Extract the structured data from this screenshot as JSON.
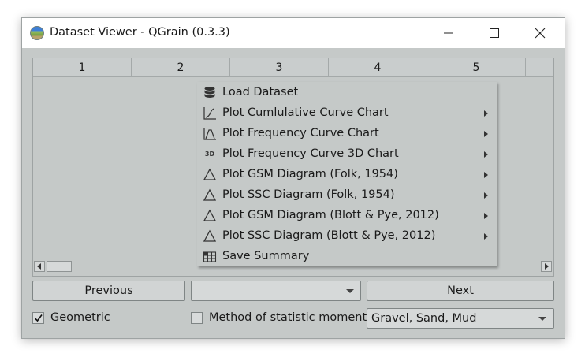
{
  "window": {
    "title": "Dataset Viewer - QGrain (0.3.3)"
  },
  "table": {
    "columns": [
      "1",
      "2",
      "3",
      "4",
      "5"
    ]
  },
  "context_menu": {
    "items": [
      {
        "label": "Load Dataset",
        "icon": "database-icon",
        "submenu": false
      },
      {
        "label": "Plot Cumlulative Curve Chart",
        "icon": "cumulative-chart-icon",
        "submenu": true
      },
      {
        "label": "Plot Frequency Curve Chart",
        "icon": "frequency-chart-icon",
        "submenu": true
      },
      {
        "label": "Plot Frequency Curve 3D Chart",
        "icon": "3d-chart-icon",
        "icon_text": "3D",
        "submenu": true
      },
      {
        "label": "Plot GSM Diagram (Folk, 1954)",
        "icon": "triangle-icon",
        "submenu": true
      },
      {
        "label": "Plot SSC Diagram (Folk, 1954)",
        "icon": "triangle-icon",
        "submenu": true
      },
      {
        "label": "Plot GSM Diagram (Blott & Pye, 2012)",
        "icon": "triangle-icon",
        "submenu": true
      },
      {
        "label": "Plot SSC Diagram (Blott & Pye, 2012)",
        "icon": "triangle-icon",
        "submenu": true
      },
      {
        "label": "Save Summary",
        "icon": "spreadsheet-icon",
        "submenu": false
      }
    ]
  },
  "navigation": {
    "previous_label": "Previous",
    "next_label": "Next",
    "sample_combo_value": ""
  },
  "options": {
    "geometric_label": "Geometric",
    "geometric_checked": true,
    "moments_label": "Method of statistic moments",
    "moments_checked": false,
    "classification_value": "Gravel, Sand, Mud"
  }
}
